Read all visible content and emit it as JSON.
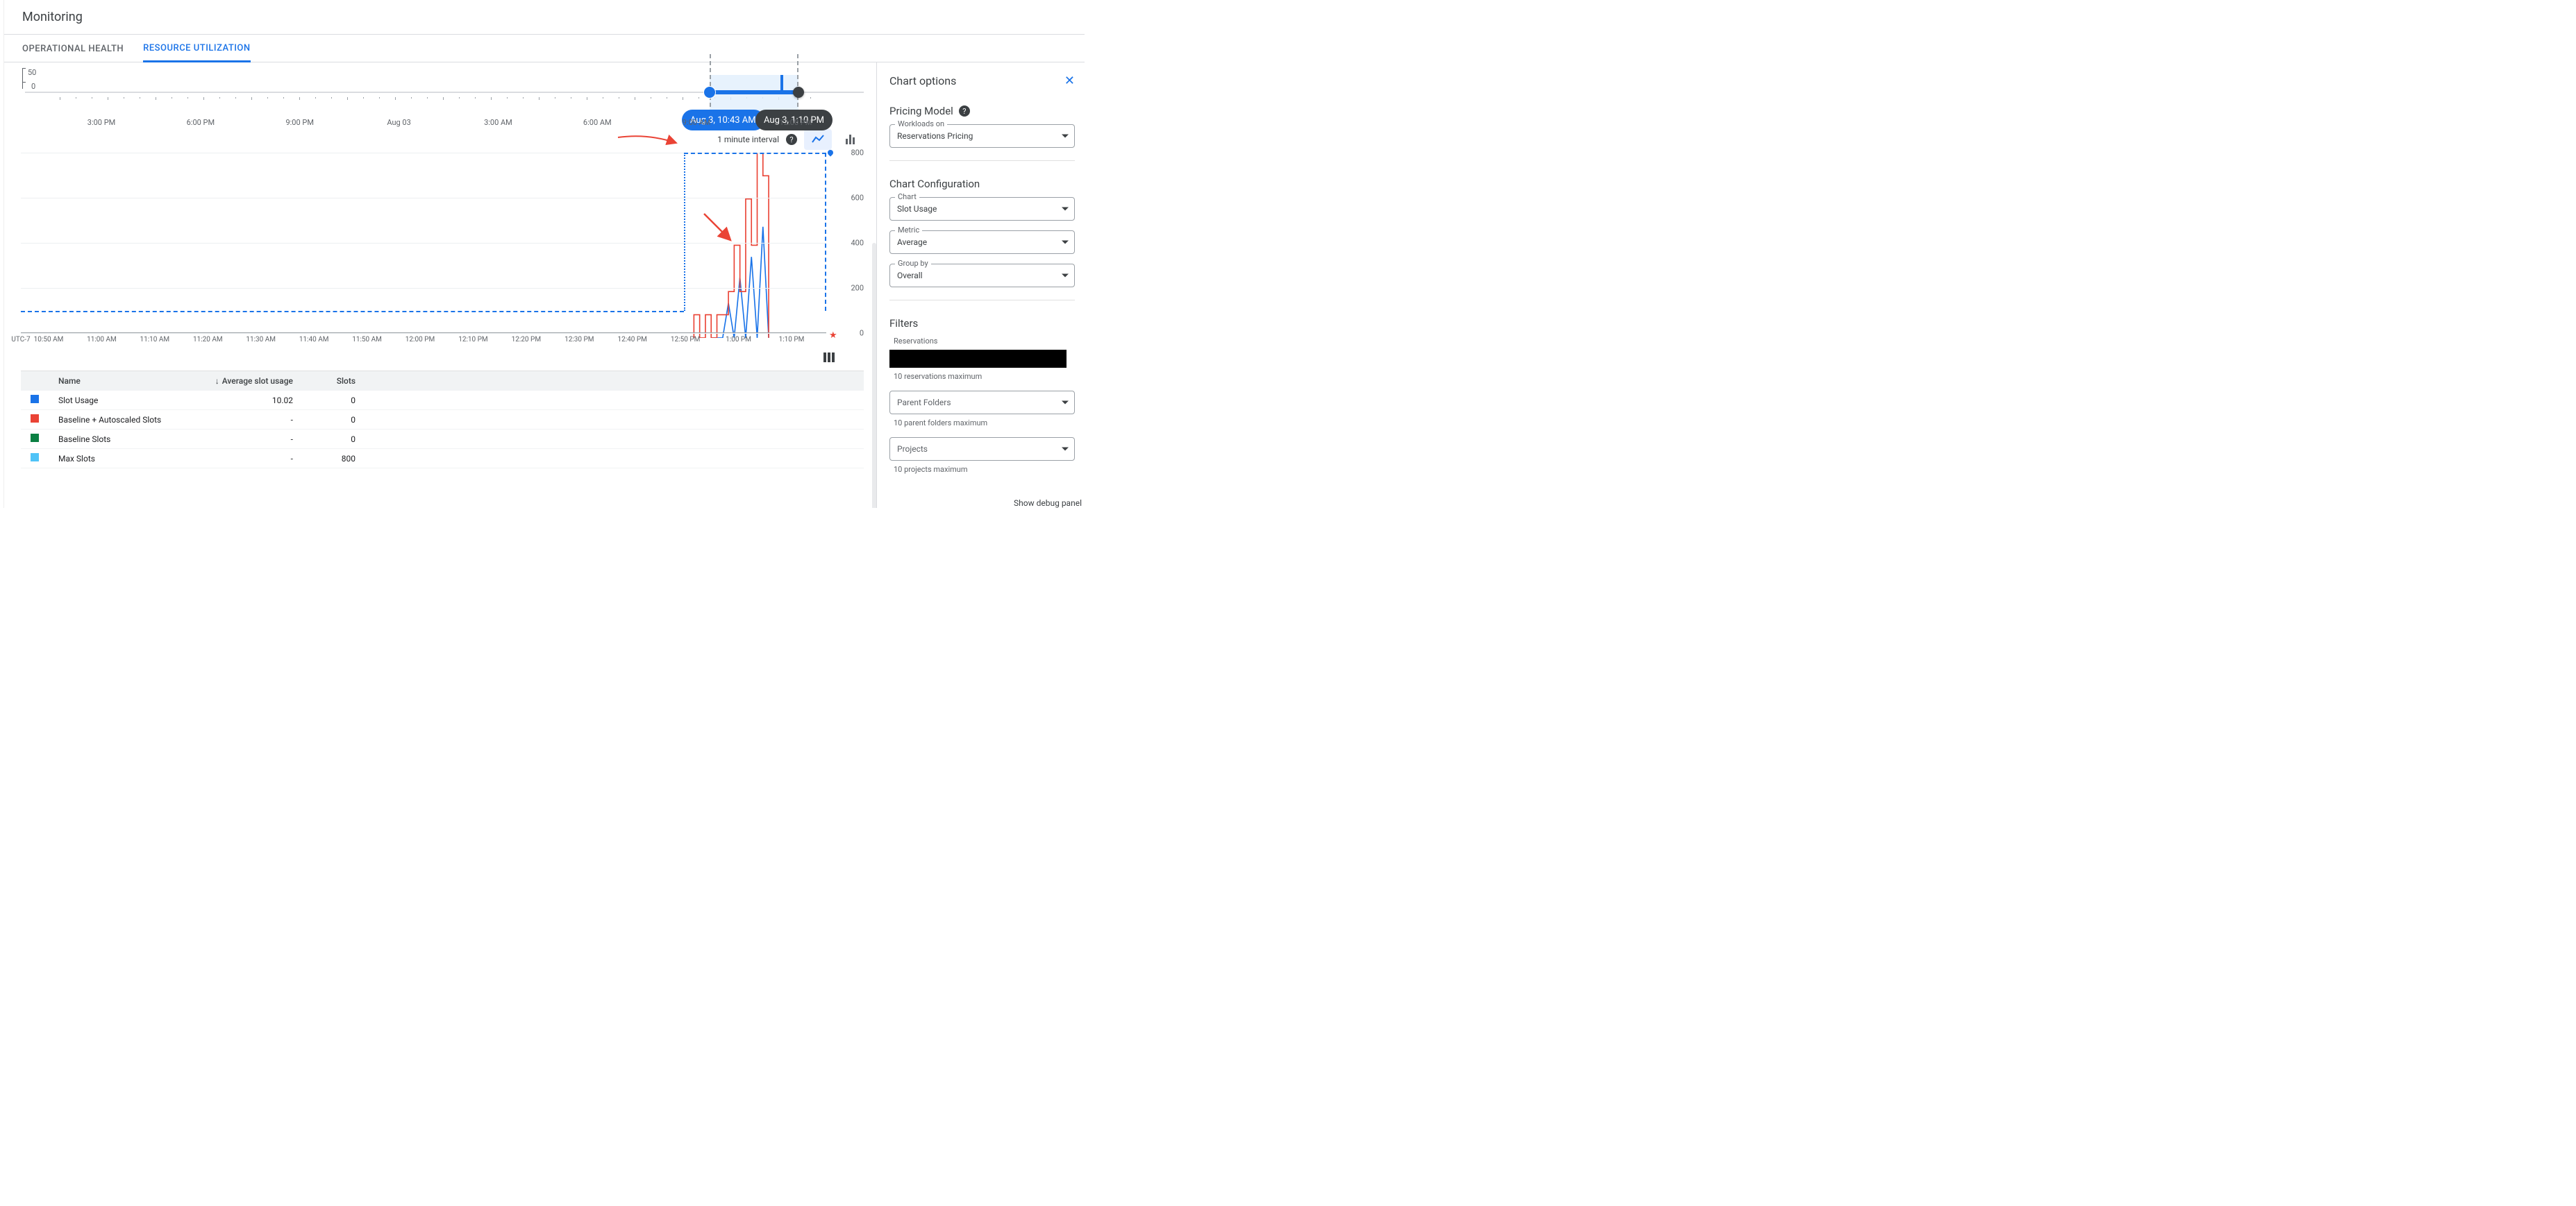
{
  "page": {
    "title": "Monitoring"
  },
  "tabs": {
    "operational": "OPERATIONAL HEALTH",
    "resourceutil": "RESOURCE UTILIZATION"
  },
  "overview": {
    "y50": "50",
    "y0": "0",
    "xlabels": [
      "3:00 PM",
      "6:00 PM",
      "9:00 PM",
      "Aug 03",
      "3:00 AM",
      "6:00 AM",
      "9:00 AM",
      "12:00 PM"
    ],
    "sel_start_badge": "Aug 3, 10:43 AM",
    "sel_end_badge": "Aug 3, 1:10 PM"
  },
  "chart_toolbar": {
    "interval": "1 minute interval"
  },
  "chart_data": {
    "type": "line",
    "title": "",
    "xlabel": "",
    "ylabel": "",
    "timezone": "UTC-7",
    "x_ticks": [
      "10:50 AM",
      "11:00 AM",
      "11:10 AM",
      "11:20 AM",
      "11:30 AM",
      "11:40 AM",
      "11:50 AM",
      "12:00 PM",
      "12:10 PM",
      "12:20 PM",
      "12:30 PM",
      "12:40 PM",
      "12:50 PM",
      "1:00 PM",
      "1:10 PM"
    ],
    "y_ticks": [
      0,
      200,
      400,
      600,
      800
    ],
    "ylim": [
      0,
      800
    ],
    "baseline_dashed": 100,
    "max_marker": 800,
    "series": [
      {
        "name": "Slot Usage",
        "color": "#1a73e8",
        "x": [
          "12:50 PM",
          "12:51 PM",
          "12:52 PM",
          "12:53 PM",
          "12:54 PM",
          "12:55 PM",
          "12:56 PM",
          "12:57 PM",
          "12:58 PM",
          "12:59 PM",
          "1:00 PM"
        ],
        "values": [
          0,
          0,
          0,
          150,
          0,
          260,
          0,
          350,
          0,
          480,
          0
        ]
      },
      {
        "name": "Baseline + Autoscaled Slots",
        "color": "#ea4335",
        "style": "step",
        "x": [
          "12:47 PM",
          "12:48 PM",
          "12:49 PM",
          "12:50 PM",
          "12:51 PM",
          "12:52 PM",
          "12:53 PM",
          "12:54 PM",
          "12:55 PM",
          "12:56 PM",
          "12:57 PM",
          "12:58 PM",
          "12:59 PM",
          "1:00 PM"
        ],
        "values": [
          100,
          0,
          100,
          0,
          100,
          100,
          200,
          400,
          200,
          600,
          400,
          800,
          700,
          100
        ]
      }
    ]
  },
  "legend": {
    "headers": {
      "name": "Name",
      "avg": "Average slot usage",
      "slots": "Slots"
    },
    "rows": [
      {
        "swatch": "#1a73e8",
        "name": "Slot Usage",
        "avg": "10.02",
        "slots": "0"
      },
      {
        "swatch": "#ea4335",
        "name": "Baseline + Autoscaled Slots",
        "avg": "-",
        "slots": "0"
      },
      {
        "swatch": "#0b8043",
        "name": "Baseline Slots",
        "avg": "-",
        "slots": "0"
      },
      {
        "swatch": "#4fc3f7",
        "name": "Max Slots",
        "avg": "-",
        "slots": "800"
      }
    ]
  },
  "right": {
    "title": "Chart options",
    "pricing_h": "Pricing Model",
    "workloads": {
      "label": "Workloads on",
      "value": "Reservations Pricing"
    },
    "config_h": "Chart Configuration",
    "chart": {
      "label": "Chart",
      "value": "Slot Usage"
    },
    "metric": {
      "label": "Metric",
      "value": "Average"
    },
    "groupby": {
      "label": "Group by",
      "value": "Overall"
    },
    "filters_h": "Filters",
    "reservations": {
      "label": "Reservations",
      "help": "10 reservations maximum"
    },
    "folders": {
      "label": "Parent Folders",
      "help": "10 parent folders maximum"
    },
    "projects": {
      "label": "Projects",
      "help": "10 projects maximum"
    },
    "debug": "Show debug panel"
  }
}
